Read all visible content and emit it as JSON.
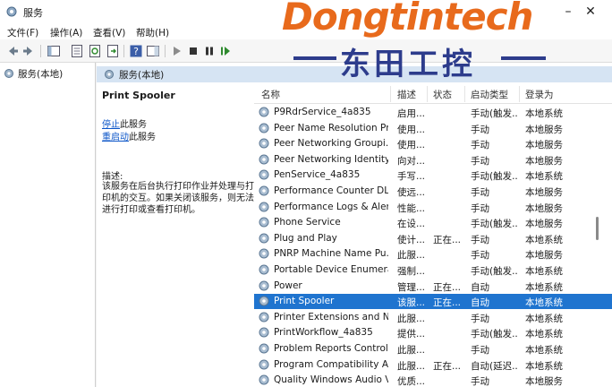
{
  "window": {
    "title": "服务"
  },
  "menu": [
    "文件(F)",
    "操作(A)",
    "查看(V)",
    "帮助(H)"
  ],
  "tree": {
    "root_label": "服务(本地)"
  },
  "pane": {
    "header": "服务(本地)"
  },
  "detail": {
    "service_name": "Print Spooler",
    "stop_link": "停止",
    "stop_suffix": "此服务",
    "restart_link": "重启动",
    "restart_suffix": "此服务",
    "desc_label": "描述:",
    "desc_text": "该服务在后台执行打印作业并处理与打印机的交互。如果关闭该服务，则无法进行打印或查看打印机。"
  },
  "columns": [
    "名称",
    "描述",
    "状态",
    "启动类型",
    "登录为"
  ],
  "services": [
    {
      "name": "P9RdrService_4a835",
      "desc": "启用...",
      "status": "",
      "startup": "手动(触发...",
      "logon": "本地系统"
    },
    {
      "name": "Peer Name Resolution Pr...",
      "desc": "使用...",
      "status": "",
      "startup": "手动",
      "logon": "本地服务"
    },
    {
      "name": "Peer Networking Groupi...",
      "desc": "使用...",
      "status": "",
      "startup": "手动",
      "logon": "本地服务"
    },
    {
      "name": "Peer Networking Identity...",
      "desc": "向对...",
      "status": "",
      "startup": "手动",
      "logon": "本地服务"
    },
    {
      "name": "PenService_4a835",
      "desc": "手写...",
      "status": "",
      "startup": "手动(触发...",
      "logon": "本地系统"
    },
    {
      "name": "Performance Counter DL...",
      "desc": "使远...",
      "status": "",
      "startup": "手动",
      "logon": "本地服务"
    },
    {
      "name": "Performance Logs & Aler...",
      "desc": "性能...",
      "status": "",
      "startup": "手动",
      "logon": "本地服务"
    },
    {
      "name": "Phone Service",
      "desc": "在设...",
      "status": "",
      "startup": "手动(触发...",
      "logon": "本地服务"
    },
    {
      "name": "Plug and Play",
      "desc": "使计...",
      "status": "正在...",
      "startup": "手动",
      "logon": "本地系统"
    },
    {
      "name": "PNRP Machine Name Pu...",
      "desc": "此服...",
      "status": "",
      "startup": "手动",
      "logon": "本地服务"
    },
    {
      "name": "Portable Device Enumera...",
      "desc": "强制...",
      "status": "",
      "startup": "手动(触发...",
      "logon": "本地系统"
    },
    {
      "name": "Power",
      "desc": "管理...",
      "status": "正在...",
      "startup": "自动",
      "logon": "本地系统"
    },
    {
      "name": "Print Spooler",
      "desc": "该服...",
      "status": "正在...",
      "startup": "自动",
      "logon": "本地系统"
    },
    {
      "name": "Printer Extensions and N...",
      "desc": "此服...",
      "status": "",
      "startup": "手动",
      "logon": "本地系统"
    },
    {
      "name": "PrintWorkflow_4a835",
      "desc": "提供...",
      "status": "",
      "startup": "手动(触发...",
      "logon": "本地系统"
    },
    {
      "name": "Problem Reports Control...",
      "desc": "此服...",
      "status": "",
      "startup": "手动",
      "logon": "本地系统"
    },
    {
      "name": "Program Compatibility A...",
      "desc": "此服...",
      "status": "正在...",
      "startup": "自动(延迟...",
      "logon": "本地系统"
    },
    {
      "name": "Quality Windows Audio V...",
      "desc": "优质...",
      "status": "",
      "startup": "手动",
      "logon": "本地服务"
    }
  ],
  "selected_index": 12,
  "watermark": {
    "en": "Dongtintech",
    "zh": "东田工控"
  },
  "colors": {
    "selection": "#1f74cf",
    "link": "#0b55c8",
    "watermark_orange": "#e86a1c",
    "watermark_blue": "#2d3c8c"
  }
}
